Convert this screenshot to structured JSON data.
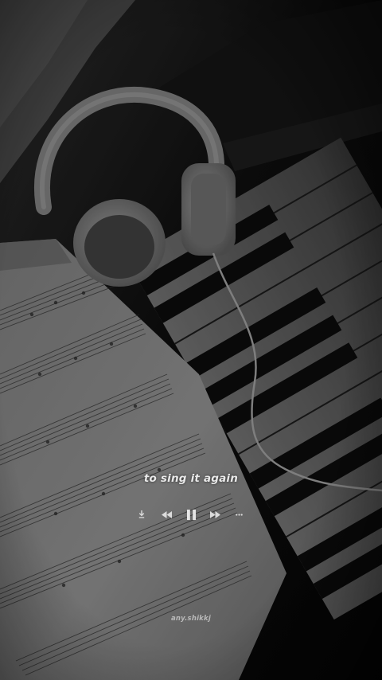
{
  "player": {
    "lyric": "to sing it again",
    "watermark": "any.shikkj",
    "controls": {
      "download_icon": "download-icon",
      "previous_icon": "rewind-icon",
      "play_state_icon": "pause-icon",
      "next_icon": "fast-forward-icon",
      "more_icon": "more-icon"
    }
  },
  "colors": {
    "text": "#e9e9e9",
    "icon": "#dcdcdc",
    "background": "#000000"
  }
}
